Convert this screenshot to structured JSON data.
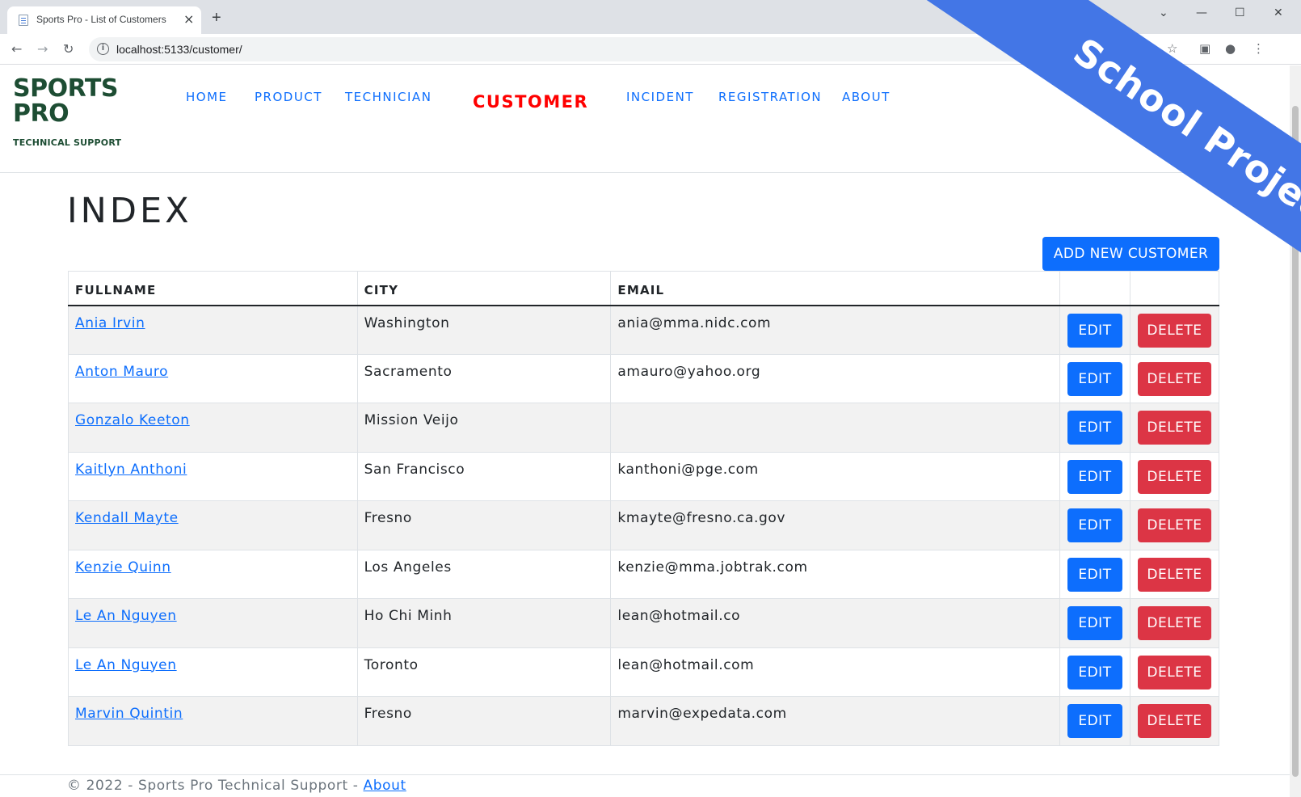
{
  "browser": {
    "tab_title": "Sports Pro - List of Customers",
    "url": "localhost:5133/customer/"
  },
  "brand": {
    "line1": "SPORTS",
    "line2": "PRO",
    "tagline": "TECHNICAL SUPPORT"
  },
  "nav": {
    "home": "HOME",
    "product": "PRODUCT",
    "technician": "TECHNICIAN",
    "customer": "CUSTOMER",
    "incident": "INCIDENT",
    "registration": "REGISTRATION",
    "about": "ABOUT",
    "active_color": "#ff0000",
    "link_color": "#0d6efd"
  },
  "page": {
    "title": "INDEX",
    "add_button": "ADD NEW CUSTOMER"
  },
  "table": {
    "headers": [
      "FULLNAME",
      "CITY",
      "EMAIL",
      "",
      ""
    ],
    "edit_label": "EDIT",
    "delete_label": "DELETE",
    "rows": [
      {
        "fullname": "Ania Irvin",
        "city": "Washington",
        "email": "ania@mma.nidc.com"
      },
      {
        "fullname": "Anton Mauro",
        "city": "Sacramento",
        "email": "amauro@yahoo.org"
      },
      {
        "fullname": "Gonzalo Keeton",
        "city": "Mission Veijo",
        "email": ""
      },
      {
        "fullname": "Kaitlyn Anthoni",
        "city": "San Francisco",
        "email": "kanthoni@pge.com"
      },
      {
        "fullname": "Kendall Mayte",
        "city": "Fresno",
        "email": "kmayte@fresno.ca.gov"
      },
      {
        "fullname": "Kenzie Quinn",
        "city": "Los Angeles",
        "email": "kenzie@mma.jobtrak.com"
      },
      {
        "fullname": "Le An Nguyen",
        "city": "Ho Chi Minh",
        "email": "lean@hotmail.co"
      },
      {
        "fullname": "Le An Nguyen",
        "city": "Toronto",
        "email": "lean@hotmail.com"
      },
      {
        "fullname": "Marvin Quintin",
        "city": "Fresno",
        "email": "marvin@expedata.com"
      }
    ]
  },
  "footer": {
    "text": "© 2022 - Sports Pro Technical Support - ",
    "link": "About"
  },
  "ribbon": {
    "text": "School Project",
    "color": "#4376e6"
  }
}
